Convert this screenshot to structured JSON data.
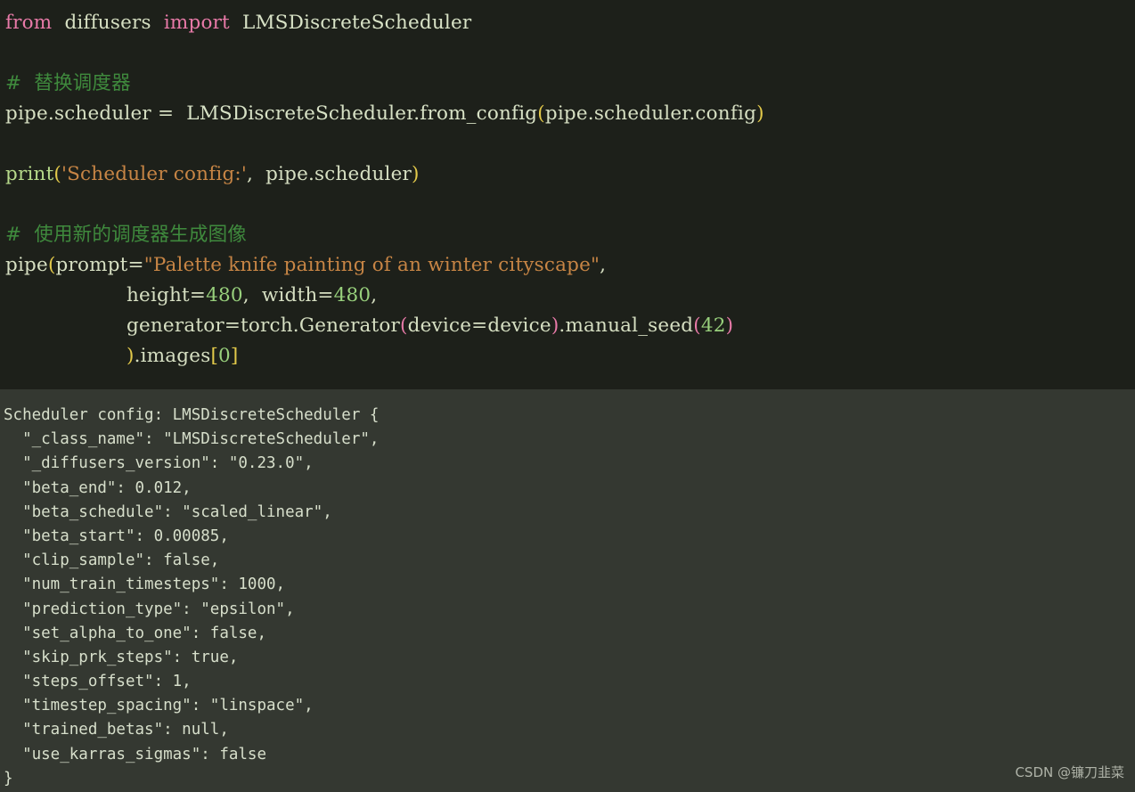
{
  "theme": {
    "code_background": "#1d201a",
    "output_background": "#343831",
    "default_text": "#d6e0cd",
    "keyword_color": "#e87aa8",
    "comment_color": "#3f8a3d",
    "string_color": "#c78545",
    "number_color": "#98d07c",
    "paren_yellow": "#e2c94a",
    "paren_magenta": "#e87aa8",
    "output_text": "#d7dfcb",
    "watermark_color": "#b9bdb2"
  },
  "code": {
    "line1": {
      "kw_from": "from",
      "module": "diffusers",
      "kw_import": "import",
      "symbol": "LMSDiscreteScheduler"
    },
    "line_blank_1": "",
    "comment1": "#  替换调度器",
    "line_assign": {
      "target": "pipe.scheduler",
      "equals": " =  ",
      "cls": "LMSDiscreteScheduler.from_config",
      "open_paren": "(",
      "arg": "pipe.scheduler.config",
      "close_paren": ")"
    },
    "line_blank_2": "",
    "line_print": {
      "fn": "print",
      "open_paren": "(",
      "string": "'Scheduler config:'",
      "comma": ",  ",
      "arg": "pipe.scheduler",
      "close_paren": ")"
    },
    "line_blank_3": "",
    "comment2": "#  使用新的调度器生成图像",
    "line_call": {
      "fn": "pipe",
      "open_paren": "(",
      "kwarg": "prompt=",
      "string": "\"Palette knife painting of an winter cityscape\"",
      "comma": ","
    },
    "line_size": {
      "height": "height=",
      "height_val": "480",
      "sep": ",  ",
      "width": "width=",
      "width_val": "480",
      "comma": ","
    },
    "line_generator": {
      "kwarg": "generator=torch.Generator",
      "open_paren": "(",
      "inner": "device=device",
      "close_paren": ")",
      "method": ".manual_seed",
      "open_paren2": "(",
      "seed": "42",
      "close_paren2": ")"
    },
    "line_tail": {
      "close_paren": ")",
      "attr": ".images",
      "open_bracket": "[",
      "index": "0",
      "close_bracket": "]"
    }
  },
  "output": {
    "lines": [
      "Scheduler config: LMSDiscreteScheduler {",
      "  \"_class_name\": \"LMSDiscreteScheduler\",",
      "  \"_diffusers_version\": \"0.23.0\",",
      "  \"beta_end\": 0.012,",
      "  \"beta_schedule\": \"scaled_linear\",",
      "  \"beta_start\": 0.00085,",
      "  \"clip_sample\": false,",
      "  \"num_train_timesteps\": 1000,",
      "  \"prediction_type\": \"epsilon\",",
      "  \"set_alpha_to_one\": false,",
      "  \"skip_prk_steps\": true,",
      "  \"steps_offset\": 1,",
      "  \"timestep_spacing\": \"linspace\",",
      "  \"trained_betas\": null,",
      "  \"use_karras_sigmas\": false",
      "}"
    ]
  },
  "watermark": {
    "text": "CSDN @镰刀韭菜"
  }
}
